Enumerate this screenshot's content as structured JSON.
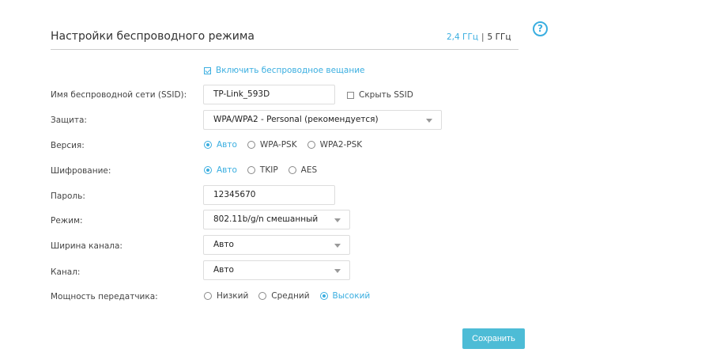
{
  "header": {
    "title": "Настройки беспроводного режима",
    "band_24": "2,4 ГГц",
    "band_sep": "|",
    "band_5": "5 ГГц",
    "help_icon": "help-circle-icon"
  },
  "broadcast": {
    "label": "Включить беспроводное вещание",
    "checked": true
  },
  "ssid": {
    "label": "Имя беспроводной сети (SSID):",
    "value": "TP-Link_593D",
    "hide_label": "Скрыть SSID",
    "hide_checked": false
  },
  "security": {
    "label": "Защита:",
    "value": "WPA/WPA2 - Personal (рекомендуется)"
  },
  "version": {
    "label": "Версия:",
    "options": [
      "Авто",
      "WPA-PSK",
      "WPA2-PSK"
    ],
    "selected": "Авто"
  },
  "encryption": {
    "label": "Шифрование:",
    "options": [
      "Авто",
      "TKIP",
      "AES"
    ],
    "selected": "Авто"
  },
  "password": {
    "label": "Пароль:",
    "value": "12345670"
  },
  "mode": {
    "label": "Режим:",
    "value": "802.11b/g/n смешанный"
  },
  "channel_width": {
    "label": "Ширина канала:",
    "value": "Авто"
  },
  "channel": {
    "label": "Канал:",
    "value": "Авто"
  },
  "tx_power": {
    "label": "Мощность передатчика:",
    "options": [
      "Низкий",
      "Средний",
      "Высокий"
    ],
    "selected": "Высокий"
  },
  "actions": {
    "save_label": "Сохранить"
  },
  "colors": {
    "accent": "#3aaee0",
    "button": "#4dbcd6"
  }
}
